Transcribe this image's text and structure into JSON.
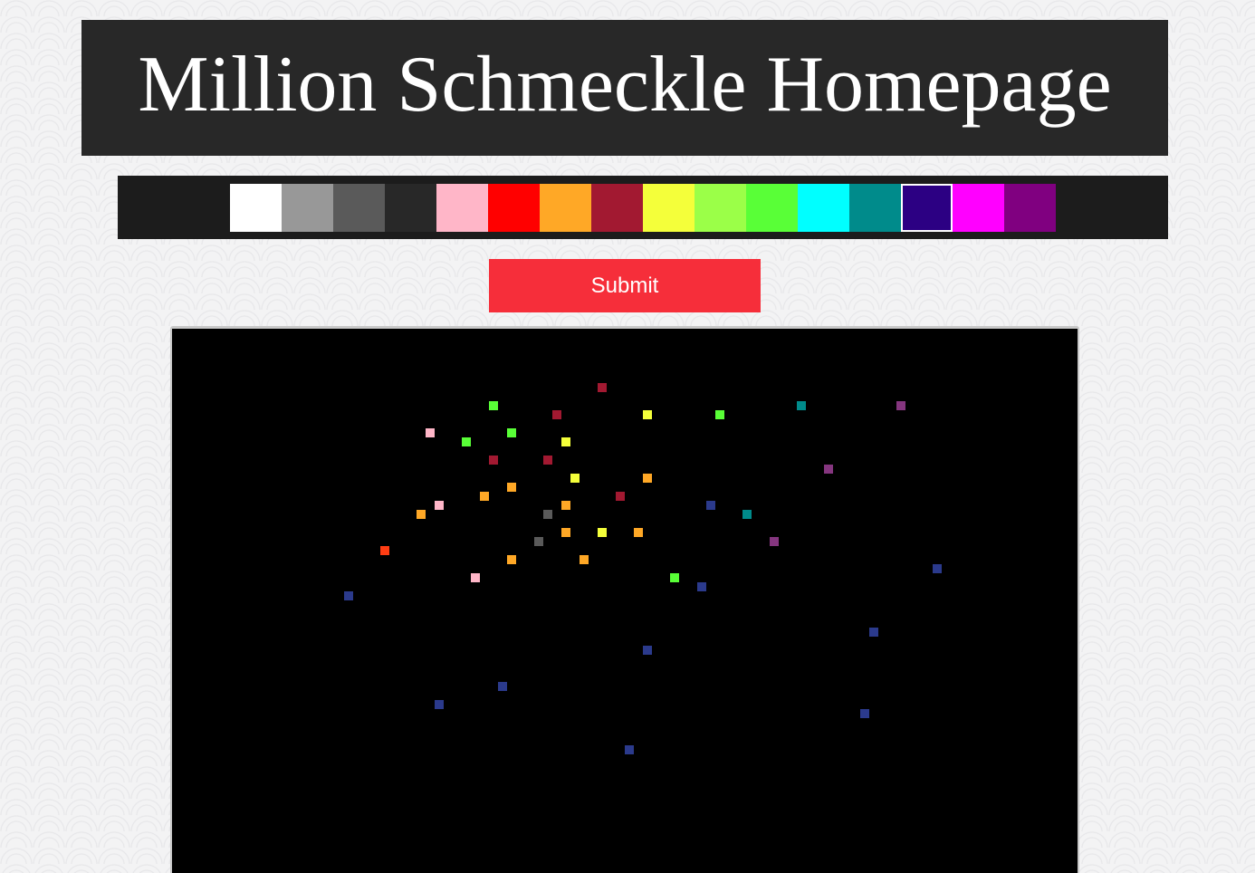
{
  "header": {
    "title": "Million Schmeckle Homepage"
  },
  "palette": {
    "selected_index": 13,
    "colors": [
      "#ffffff",
      "#989898",
      "#5a5a5a",
      "#282828",
      "#ffb6c8",
      "#ff0000",
      "#ffa826",
      "#a21931",
      "#f4ff3a",
      "#9bff48",
      "#59ff37",
      "#00ffff",
      "#008b8b",
      "#2c0083",
      "#ff00ff",
      "#800080"
    ]
  },
  "actions": {
    "submit_label": "Submit"
  },
  "canvas": {
    "background": "#000000",
    "pixels": [
      {
        "col": 47,
        "row": 6,
        "color": "#a21931"
      },
      {
        "col": 35,
        "row": 8,
        "color": "#59ff37"
      },
      {
        "col": 69,
        "row": 8,
        "color": "#008b8b"
      },
      {
        "col": 80,
        "row": 8,
        "color": "#85367f"
      },
      {
        "col": 42,
        "row": 9,
        "color": "#a21931"
      },
      {
        "col": 52,
        "row": 9,
        "color": "#f4ff3a"
      },
      {
        "col": 60,
        "row": 9,
        "color": "#59ff37"
      },
      {
        "col": 28,
        "row": 11,
        "color": "#ffb6c8"
      },
      {
        "col": 37,
        "row": 11,
        "color": "#59ff37"
      },
      {
        "col": 32,
        "row": 12,
        "color": "#59ff37"
      },
      {
        "col": 43,
        "row": 12,
        "color": "#f4ff3a"
      },
      {
        "col": 35,
        "row": 14,
        "color": "#a21931"
      },
      {
        "col": 41,
        "row": 14,
        "color": "#a21931"
      },
      {
        "col": 72,
        "row": 15,
        "color": "#85367f"
      },
      {
        "col": 44,
        "row": 16,
        "color": "#f4ff3a"
      },
      {
        "col": 52,
        "row": 16,
        "color": "#ffa826"
      },
      {
        "col": 37,
        "row": 17,
        "color": "#ffa826"
      },
      {
        "col": 34,
        "row": 18,
        "color": "#ffa826"
      },
      {
        "col": 49,
        "row": 18,
        "color": "#a21931"
      },
      {
        "col": 29,
        "row": 19,
        "color": "#ffb6c8"
      },
      {
        "col": 43,
        "row": 19,
        "color": "#ffa826"
      },
      {
        "col": 59,
        "row": 19,
        "color": "#2b3a8c"
      },
      {
        "col": 27,
        "row": 20,
        "color": "#ffa826"
      },
      {
        "col": 41,
        "row": 20,
        "color": "#5a5a5a"
      },
      {
        "col": 63,
        "row": 20,
        "color": "#008b8b"
      },
      {
        "col": 43,
        "row": 22,
        "color": "#ffa826"
      },
      {
        "col": 47,
        "row": 22,
        "color": "#f4ff3a"
      },
      {
        "col": 51,
        "row": 22,
        "color": "#ffa826"
      },
      {
        "col": 40,
        "row": 23,
        "color": "#5a5a5a"
      },
      {
        "col": 66,
        "row": 23,
        "color": "#85367f"
      },
      {
        "col": 23,
        "row": 24,
        "color": "#ff3d13"
      },
      {
        "col": 37,
        "row": 25,
        "color": "#ffa826"
      },
      {
        "col": 45,
        "row": 25,
        "color": "#ffa826"
      },
      {
        "col": 84,
        "row": 26,
        "color": "#2b3a8c"
      },
      {
        "col": 33,
        "row": 27,
        "color": "#ffb6c8"
      },
      {
        "col": 55,
        "row": 27,
        "color": "#59ff37"
      },
      {
        "col": 58,
        "row": 28,
        "color": "#2b3a8c"
      },
      {
        "col": 19,
        "row": 29,
        "color": "#2b3a8c"
      },
      {
        "col": 77,
        "row": 33,
        "color": "#2b3a8c"
      },
      {
        "col": 52,
        "row": 35,
        "color": "#2b3a8c"
      },
      {
        "col": 36,
        "row": 39,
        "color": "#2b3a8c"
      },
      {
        "col": 29,
        "row": 41,
        "color": "#2b3a8c"
      },
      {
        "col": 76,
        "row": 42,
        "color": "#2b3a8c"
      },
      {
        "col": 50,
        "row": 46,
        "color": "#2b3a8c"
      }
    ]
  }
}
